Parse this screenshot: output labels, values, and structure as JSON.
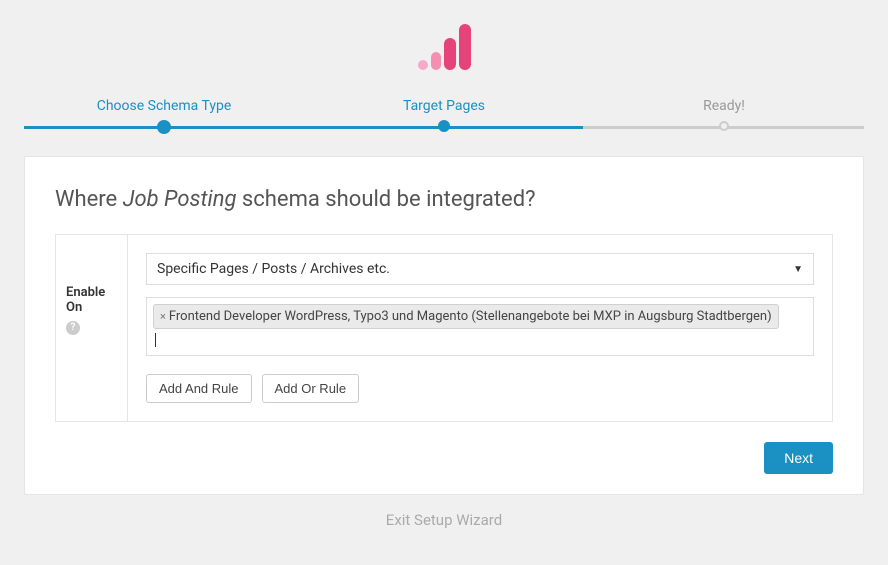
{
  "stepper": {
    "steps": [
      {
        "label": "Choose Schema Type",
        "state": "done"
      },
      {
        "label": "Target Pages",
        "state": "current"
      },
      {
        "label": "Ready!",
        "state": "future"
      }
    ]
  },
  "heading": {
    "prefix": "Where ",
    "em": "Job Posting",
    "suffix": " schema should be integrated?"
  },
  "rule": {
    "label_line1": "Enable",
    "label_line2": "On",
    "select_value": "Specific Pages / Posts / Archives etc.",
    "tags": [
      "Frontend Developer WordPress, Typo3 und Magento (Stellenangebote bei MXP in Augsburg Stadtbergen)"
    ],
    "add_and_label": "Add And Rule",
    "add_or_label": "Add Or Rule"
  },
  "footer": {
    "next_label": "Next",
    "exit_label": "Exit Setup Wizard"
  }
}
